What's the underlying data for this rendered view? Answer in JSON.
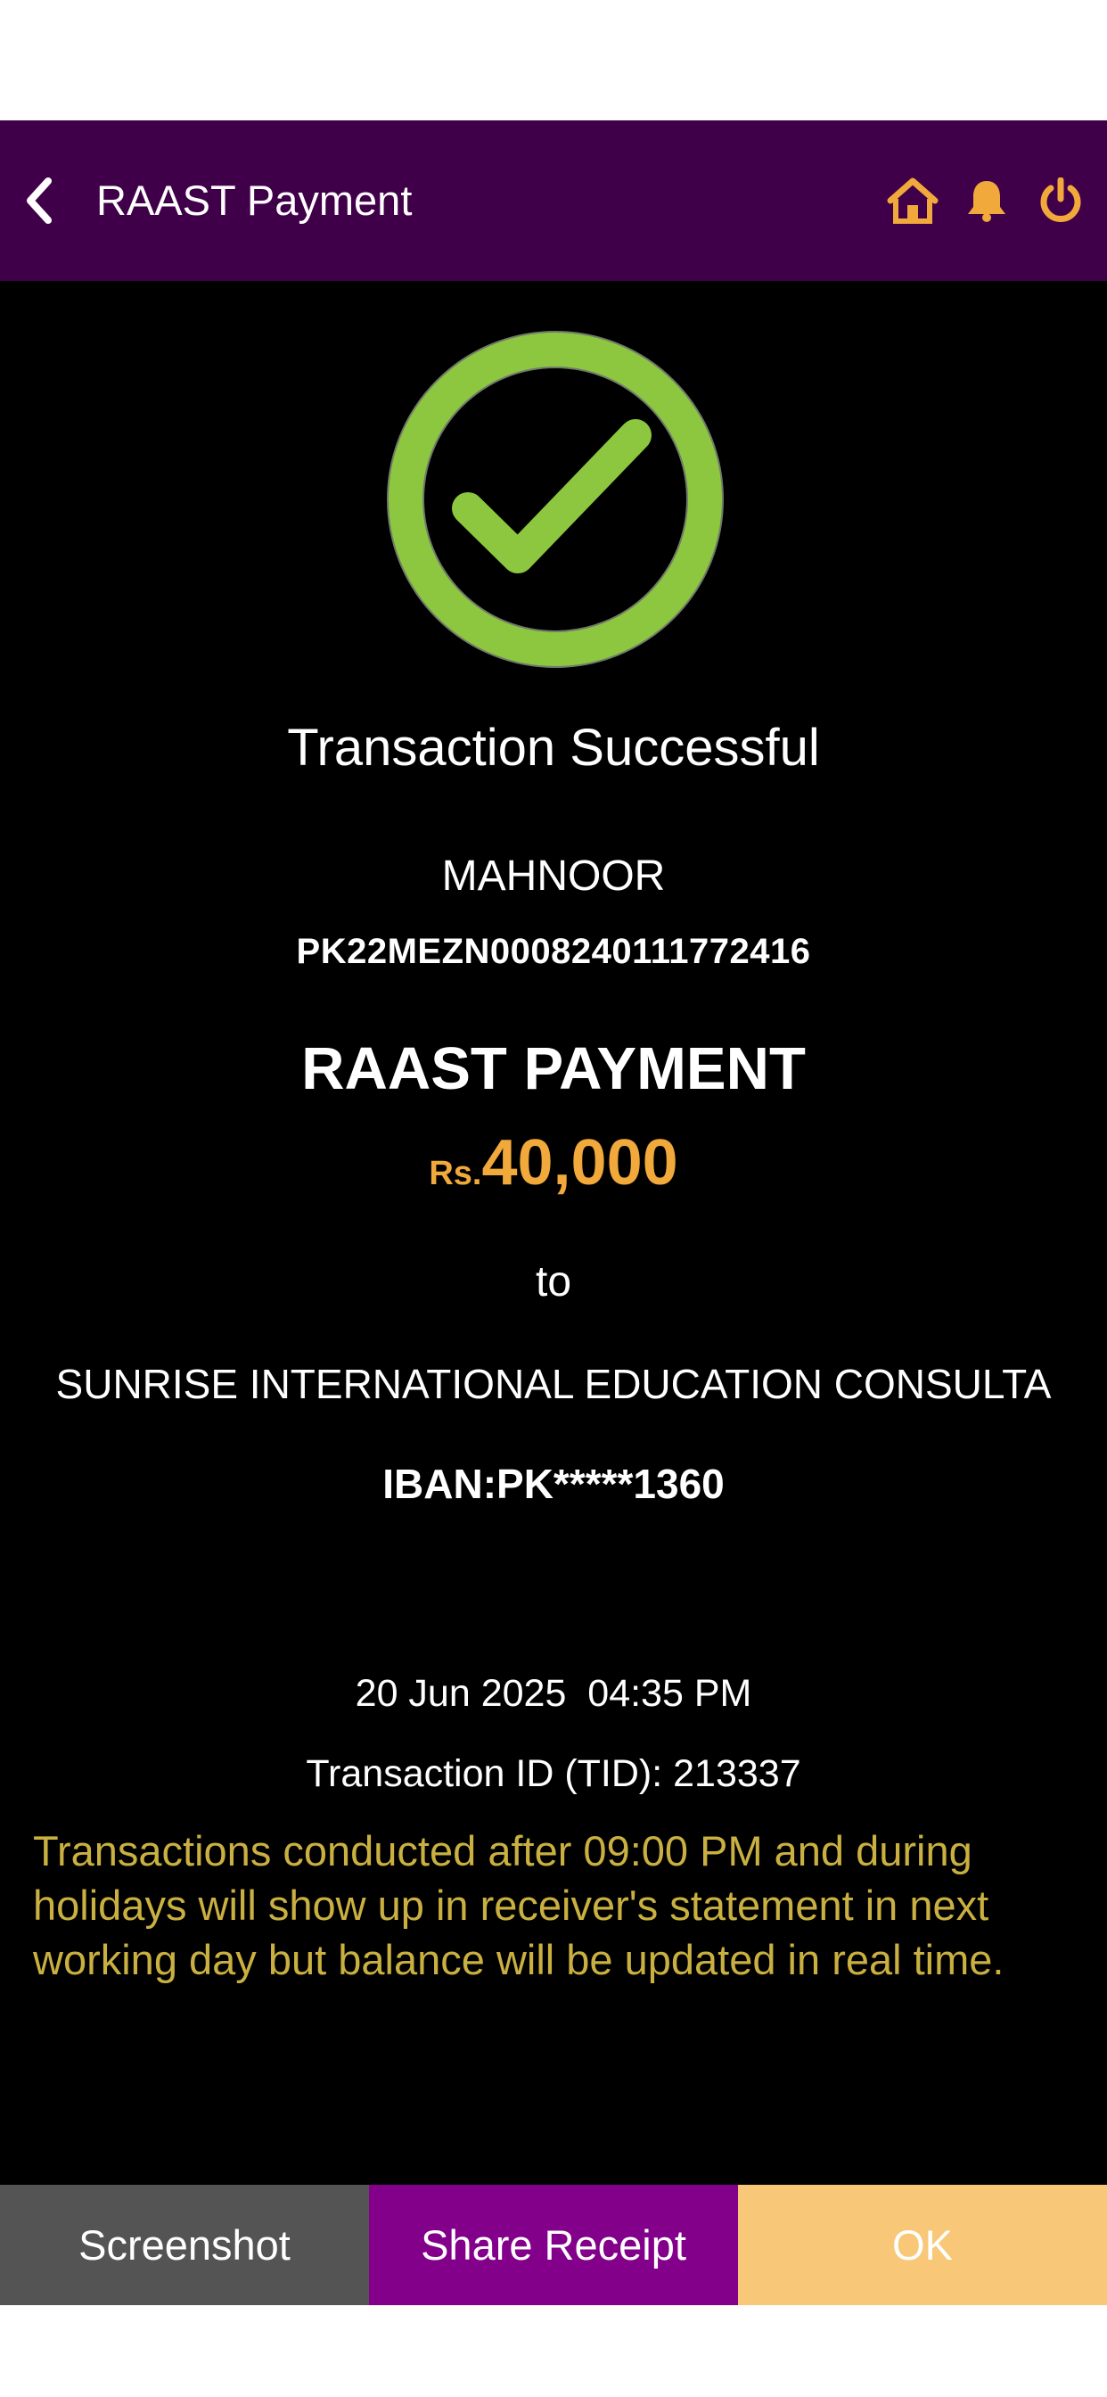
{
  "header": {
    "title": "RAAST Payment",
    "icons": [
      "back-chevron-icon",
      "home-icon",
      "bell-icon",
      "power-icon"
    ],
    "background_color": "#400049",
    "icon_color": "#f0a93a"
  },
  "receipt": {
    "status": "Transaction Successful",
    "sender_name": "MAHNOOR",
    "sender_iban": "PK22MEZN0008240111772416",
    "payment_type": "RAAST PAYMENT",
    "currency": "Rs.",
    "amount": "40,000",
    "to_label": "to",
    "recipient_name": "SUNRISE INTERNATIONAL EDUCATION CONSULTA",
    "recipient_iban": "IBAN:PK*****1360",
    "date": "20 Jun 2025",
    "time": "04:35 PM",
    "transaction_id": "Transaction ID (TID): 213337",
    "notice": "Transactions conducted after 09:00 PM and during holidays will show up in receiver's statement in next working day but balance will be updated in real time.",
    "success_icon": "check-circle-icon",
    "success_color": "#8dc63f",
    "amount_color": "#f0a93a",
    "notice_color": "#c9b040"
  },
  "footer": {
    "screenshot_label": "Screenshot",
    "share_label": "Share Receipt",
    "ok_label": "OK",
    "colors": {
      "screenshot": "#545454",
      "share": "#82008a",
      "ok": "#f8c878"
    }
  }
}
